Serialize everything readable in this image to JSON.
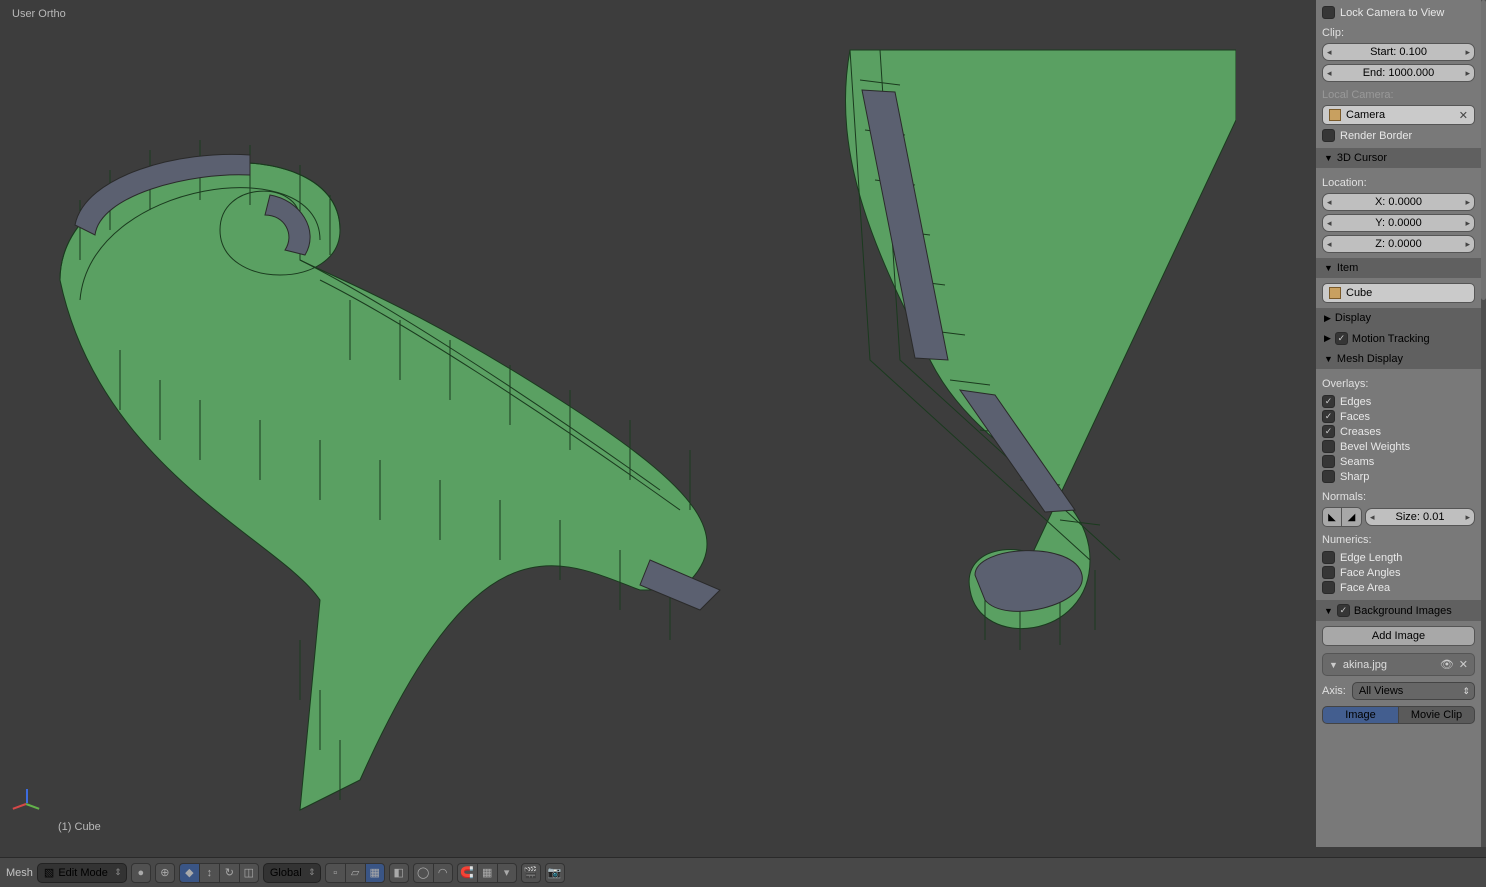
{
  "viewport": {
    "top_label": "User Ortho",
    "bottom_label": "(1) Cube"
  },
  "sidebar": {
    "lock_camera": "Lock Camera to View",
    "clip_label": "Clip:",
    "clip_start": "Start: 0.100",
    "clip_end": "End: 1000.000",
    "local_camera_label": "Local Camera:",
    "local_camera_value": "Camera",
    "render_border": "Render Border",
    "cursor_header": "3D Cursor",
    "location_label": "Location:",
    "cursor_x": "X: 0.0000",
    "cursor_y": "Y: 0.0000",
    "cursor_z": "Z: 0.0000",
    "item_header": "Item",
    "item_value": "Cube",
    "display_header": "Display",
    "motion_header": "Motion Tracking",
    "meshdisplay_header": "Mesh Display",
    "overlays_label": "Overlays:",
    "overlays": [
      {
        "label": "Edges",
        "checked": true
      },
      {
        "label": "Faces",
        "checked": true
      },
      {
        "label": "Creases",
        "checked": true
      },
      {
        "label": "Bevel Weights",
        "checked": false
      },
      {
        "label": "Seams",
        "checked": false
      },
      {
        "label": "Sharp",
        "checked": false
      }
    ],
    "normals_label": "Normals:",
    "normals_size": "Size: 0.01",
    "numerics_label": "Numerics:",
    "numerics": [
      {
        "label": "Edge Length",
        "checked": false
      },
      {
        "label": "Face Angles",
        "checked": false
      },
      {
        "label": "Face Area",
        "checked": false
      }
    ],
    "bgimages_header": "Background Images",
    "add_image_btn": "Add Image",
    "bg_file": "akina.jpg",
    "axis_label": "Axis:",
    "axis_value": "All Views",
    "tab_image": "Image",
    "tab_movie": "Movie Clip"
  },
  "bottombar": {
    "editor": "Mesh",
    "mode": "Edit Mode",
    "orientation": "Global"
  }
}
